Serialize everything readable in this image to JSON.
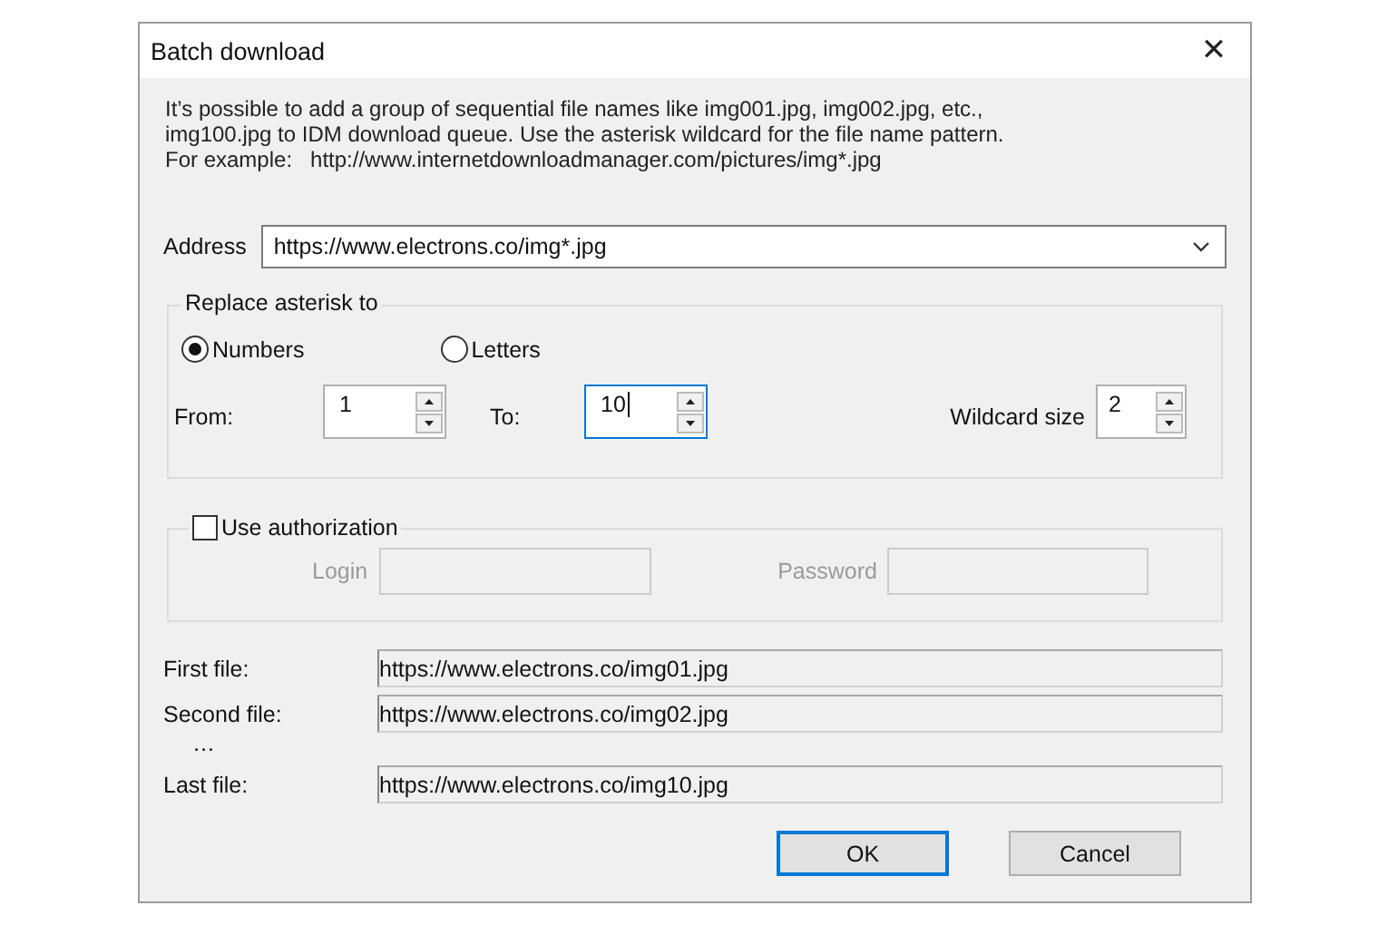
{
  "window": {
    "title": "Batch download",
    "close": "✕"
  },
  "description_lines": [
    "It’s possible to add a group of sequential file names like img001.jpg, img002.jpg, etc.,",
    "img100.jpg to IDM download queue. Use the asterisk wildcard for the file name pattern.",
    "For example:   http://www.internetdownloadmanager.com/pictures/img*.jpg"
  ],
  "address": {
    "label": "Address",
    "value": "https://www.electrons.co/img*.jpg"
  },
  "replace_group": {
    "title": "Replace asterisk to",
    "radios": [
      {
        "label": "Numbers",
        "selected": true
      },
      {
        "label": "Letters",
        "selected": false
      }
    ],
    "spinners": [
      {
        "label": "From:",
        "value": "1",
        "focused": false
      },
      {
        "label": "To:",
        "value": "10",
        "focused": true
      },
      {
        "label": "Wildcard size",
        "value": "2",
        "focused": false
      }
    ]
  },
  "auth_group": {
    "label": "Use authorization",
    "checked": false,
    "fields": [
      {
        "label": "Login",
        "disabled": true
      },
      {
        "label": "Password",
        "disabled": true
      }
    ]
  },
  "files": [
    {
      "label": "First file:",
      "value": "https://www.electrons.co/img01.jpg"
    },
    {
      "label": "Second file:",
      "value": "https://www.electrons.co/img02.jpg"
    },
    {
      "label": "…"
    },
    {
      "label": "Last file:",
      "value": "https://www.electrons.co/img10.jpg"
    }
  ],
  "buttons": [
    {
      "label": "OK",
      "default": true
    },
    {
      "label": "Cancel",
      "default": false
    }
  ]
}
